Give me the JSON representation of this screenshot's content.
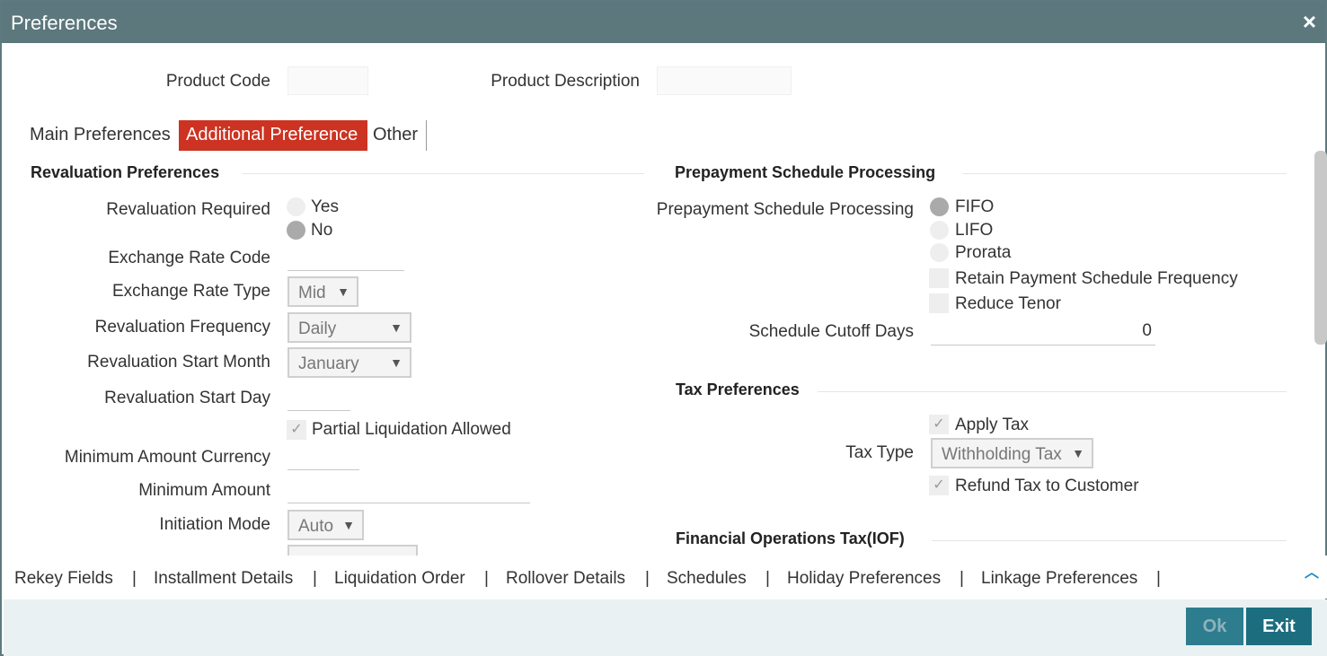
{
  "window": {
    "title": "Preferences",
    "close_icon": "×"
  },
  "header": {
    "product_code_label": "Product Code",
    "product_code_value": "",
    "product_description_label": "Product Description",
    "product_description_value": ""
  },
  "tabs": [
    {
      "label": "Main Preferences",
      "active": false
    },
    {
      "label": "Additional Preference",
      "active": true
    },
    {
      "label": "Other",
      "active": false
    }
  ],
  "revaluation": {
    "section_title": "Revaluation Preferences",
    "revaluation_required_label": "Revaluation Required",
    "options": [
      {
        "label": "Yes",
        "selected": false
      },
      {
        "label": "No",
        "selected": true
      }
    ],
    "exchange_rate_code_label": "Exchange Rate Code",
    "exchange_rate_code_value": "",
    "exchange_rate_type_label": "Exchange Rate Type",
    "exchange_rate_type_value": "Mid",
    "revaluation_frequency_label": "Revaluation Frequency",
    "revaluation_frequency_value": "Daily",
    "revaluation_start_month_label": "Revaluation Start Month",
    "revaluation_start_month_value": "January",
    "revaluation_start_day_label": "Revaluation Start Day",
    "revaluation_start_day_value": "",
    "partial_liquidation_label": "Partial Liquidation Allowed",
    "partial_liquidation_checked": true,
    "minimum_amount_currency_label": "Minimum Amount Currency",
    "minimum_amount_currency_value": "",
    "minimum_amount_label": "Minimum Amount",
    "minimum_amount_value": "",
    "initiation_mode_label": "Initiation Mode",
    "initiation_mode_value": "Auto"
  },
  "prepayment": {
    "section_title": "Prepayment Schedule Processing",
    "processing_label": "Prepayment Schedule Processing",
    "options": [
      {
        "label": "FIFO",
        "selected": true
      },
      {
        "label": "LIFO",
        "selected": false
      },
      {
        "label": "Prorata",
        "selected": false
      }
    ],
    "retain_frequency_label": "Retain Payment Schedule Frequency",
    "retain_frequency_checked": false,
    "reduce_tenor_label": "Reduce Tenor",
    "reduce_tenor_checked": false,
    "cutoff_days_label": "Schedule Cutoff Days",
    "cutoff_days_value": "0"
  },
  "tax": {
    "section_title": "Tax Preferences",
    "apply_tax_label": "Apply Tax",
    "apply_tax_checked": true,
    "tax_type_label": "Tax Type",
    "tax_type_value": "Withholding Tax",
    "refund_tax_label": "Refund Tax to Customer",
    "refund_tax_checked": true
  },
  "iof": {
    "section_title": "Financial Operations Tax(IOF)"
  },
  "footer_links": [
    "Rekey Fields",
    "Installment Details",
    "Liquidation Order",
    "Rollover Details",
    "Schedules",
    "Holiday Preferences",
    "Linkage Preferences"
  ],
  "footer_separator": "|",
  "buttons": {
    "ok_label": "Ok",
    "exit_label": "Exit"
  },
  "colors": {
    "titlebar": "#5c787d",
    "active_tab": "#cc3322",
    "button": "#1c6e7f"
  }
}
